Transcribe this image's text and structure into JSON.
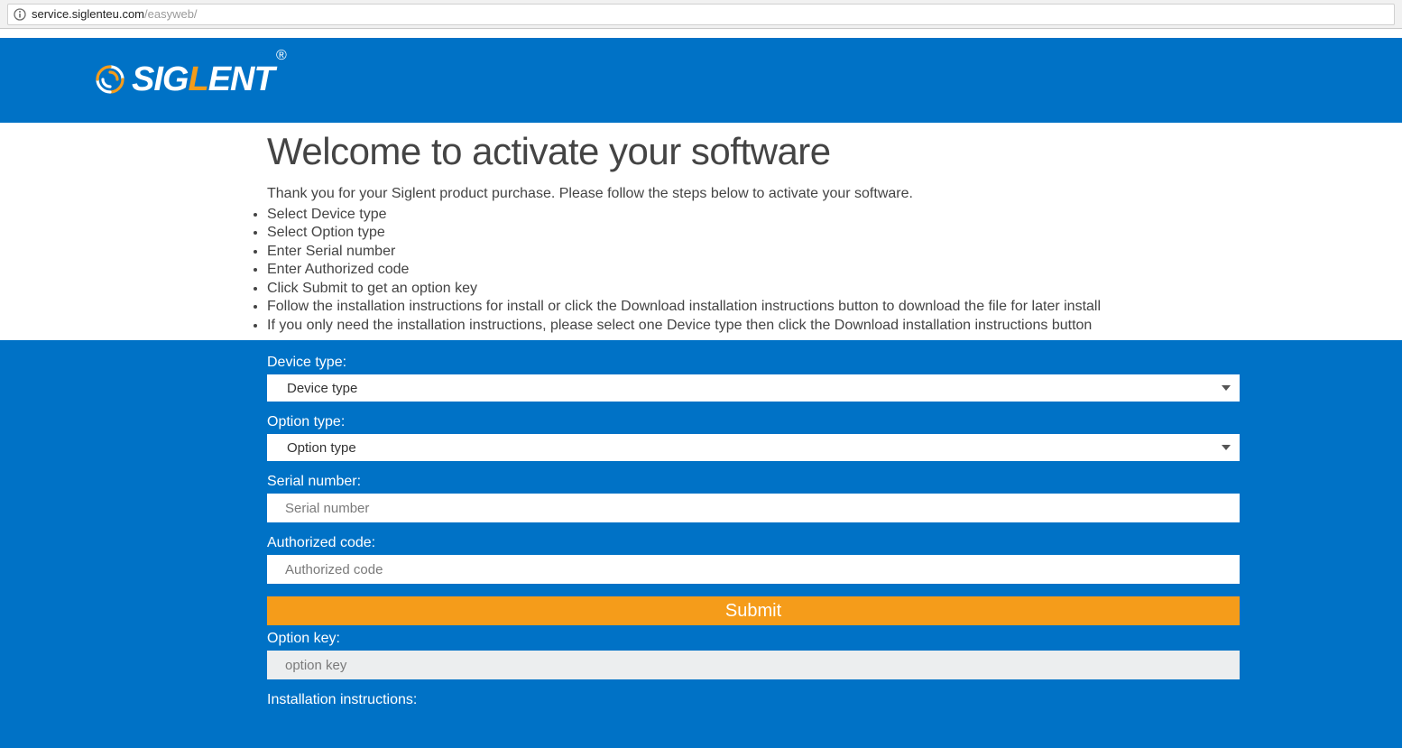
{
  "address": {
    "host": "service.siglenteu.com",
    "path": "/easyweb/"
  },
  "logo": {
    "pre": "SIG",
    "mid": "L",
    "post": "ENT",
    "reg": "®"
  },
  "intro": {
    "title": "Welcome to activate your software",
    "thanks": "Thank you for your Siglent product purchase. Please follow the steps below to activate your software.",
    "steps": [
      "Select Device type",
      "Select Option type",
      "Enter Serial number",
      "Enter Authorized code",
      "Click Submit to get an option key",
      "Follow the installation instructions for install or click the Download installation instructions button to download the file for later install",
      "If you only need the installation instructions, please select one Device type then click the Download installation instructions button"
    ]
  },
  "form": {
    "device_type": {
      "label": "Device type:",
      "value": "Device type"
    },
    "option_type": {
      "label": "Option type:",
      "value": "Option type"
    },
    "serial": {
      "label": "Serial number:",
      "placeholder": "Serial number"
    },
    "auth": {
      "label": "Authorized code:",
      "placeholder": "Authorized code"
    },
    "submit": "Submit",
    "option_key": {
      "label": "Option key:",
      "placeholder": "option key"
    },
    "install": {
      "label": "Installation instructions:"
    }
  }
}
